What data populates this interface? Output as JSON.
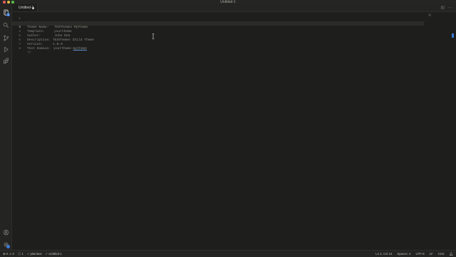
{
  "window": {
    "title": "Untitled-1"
  },
  "tabs": [
    {
      "label": "Untitled-1",
      "dirty": true
    }
  ],
  "editor": {
    "lines": [
      {
        "num": "1",
        "text": "/*"
      },
      {
        "num": "2",
        "key": "Theme Name:",
        "value": "TESThemes MyTheme"
      },
      {
        "num": "3",
        "key": "Template:",
        "value": "yourtheme"
      },
      {
        "num": "4",
        "key": "Author:",
        "value": "John Doe"
      },
      {
        "num": "5",
        "key": "Description:",
        "value": "TESThemes Child Theme"
      },
      {
        "num": "6",
        "key": "Version:",
        "value": "1.0.0"
      },
      {
        "num": "7",
        "key": "Text Domain:",
        "value_prefix": "yourtheme-",
        "value_link": "mytheme"
      },
      {
        "num": "8",
        "text": "*/"
      }
    ],
    "active_line": 3
  },
  "activity_bar": {
    "icons": [
      "explorer-icon",
      "search-icon",
      "source-control-icon",
      "run-debug-icon",
      "extensions-icon"
    ],
    "bottom_icons": [
      "account-icon",
      "settings-icon"
    ],
    "explorer_badge": "1"
  },
  "statusbar": {
    "left": {
      "problems_errors": "0",
      "problems_warnings": "0",
      "info": "1",
      "branch": "plaintext",
      "file": "Untitled-1"
    },
    "right": {
      "position": "Ln 3, Col 24",
      "spaces": "Spaces: 4",
      "encoding": "UTF-8",
      "eol": "LF",
      "language": "CSS"
    }
  },
  "colors": {
    "accent": "#3a7bd5",
    "background": "#1e1e1c"
  }
}
